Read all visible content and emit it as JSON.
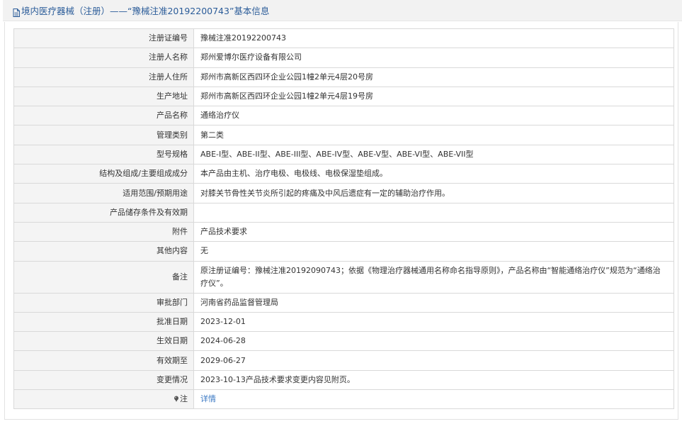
{
  "header": {
    "title": "境内医疗器械（注册）——“豫械注准20192200743”基本信息",
    "icon": "document-icon"
  },
  "rows": [
    {
      "label": "注册证编号",
      "value": "豫械注准20192200743"
    },
    {
      "label": "注册人名称",
      "value": "郑州爱博尔医疗设备有限公司"
    },
    {
      "label": "注册人住所",
      "value": "郑州市高新区西四环企业公园1幢2单元4层20号房"
    },
    {
      "label": "生产地址",
      "value": "郑州市高新区西四环企业公园1幢2单元4层19号房"
    },
    {
      "label": "产品名称",
      "value": "通络治疗仪"
    },
    {
      "label": "管理类别",
      "value": "第二类"
    },
    {
      "label": "型号规格",
      "value": "ABE-I型、ABE-II型、ABE-III型、ABE-IV型、ABE-V型、ABE-VI型、ABE-VII型"
    },
    {
      "label": "结构及组成/主要组成成分",
      "value": "本产品由主机、治疗电极、电极线、电极保湿垫组成。"
    },
    {
      "label": "适用范围/预期用途",
      "value": "对膝关节骨性关节炎所引起的疼痛及中风后遗症有一定的辅助治疗作用。"
    },
    {
      "label": "产品储存条件及有效期",
      "value": ""
    },
    {
      "label": "附件",
      "value": "产品技术要求"
    },
    {
      "label": "其他内容",
      "value": "无"
    },
    {
      "label": "备注",
      "value": "原注册证编号：豫械注准20192090743；依据《物理治疗器械通用名称命名指导原则》，产品名称由“智能通络治疗仪”规范为“通络治疗仪”。"
    },
    {
      "label": "审批部门",
      "value": "河南省药品监督管理局"
    },
    {
      "label": "批准日期",
      "value": "2023-12-01"
    },
    {
      "label": "生效日期",
      "value": "2024-06-28"
    },
    {
      "label": "有效期至",
      "value": "2029-06-27"
    },
    {
      "label": "变更情况",
      "value": "2023-10-13产品技术要求变更内容见附页。"
    }
  ],
  "note_row": {
    "label": "注",
    "icon": "pin-icon",
    "link_text": "详情"
  },
  "colors": {
    "header_bg": "#f2f2f2",
    "title_color": "#2b5c99",
    "label_bg": "#f4f4f4",
    "border": "#d9d9d9",
    "link": "#3a78c3"
  }
}
